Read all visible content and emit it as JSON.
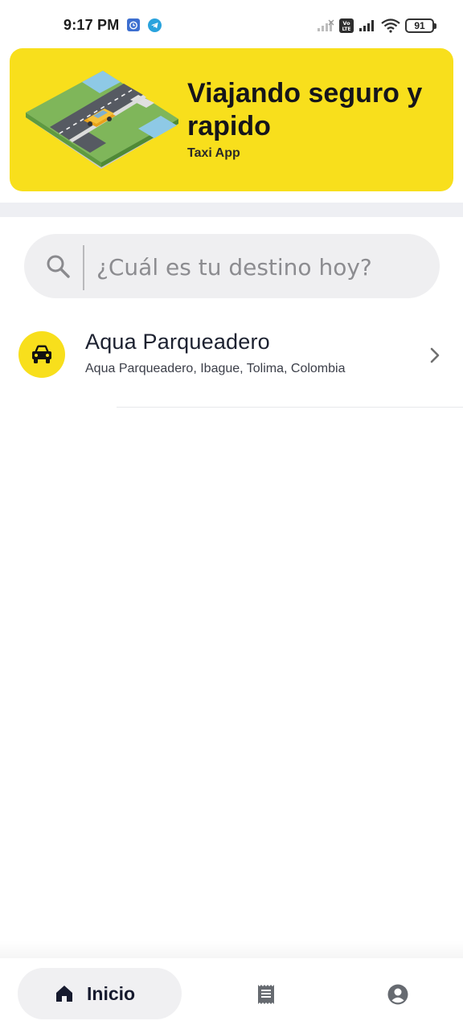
{
  "status_bar": {
    "time": "9:17 PM",
    "battery": "91",
    "network_badge": "Vo LTE"
  },
  "banner": {
    "title": "Viajando seguro y rapido",
    "subtitle": "Taxi App",
    "color": "#f8df1c"
  },
  "search": {
    "placeholder": "¿Cuál es tu destino hoy?",
    "value": ""
  },
  "places": [
    {
      "title": "Aqua Parqueadero",
      "subtitle": "Aqua Parqueadero, Ibague, Tolima, Colombia",
      "icon": "car-icon"
    }
  ],
  "bottom_nav": {
    "home_label": "Inicio",
    "items": [
      "home-icon",
      "receipt-icon",
      "account-circle-icon"
    ]
  },
  "colors": {
    "accent": "#f8df1c",
    "text_dark": "#1c2130",
    "nav_pill": "#f0f0f2"
  }
}
